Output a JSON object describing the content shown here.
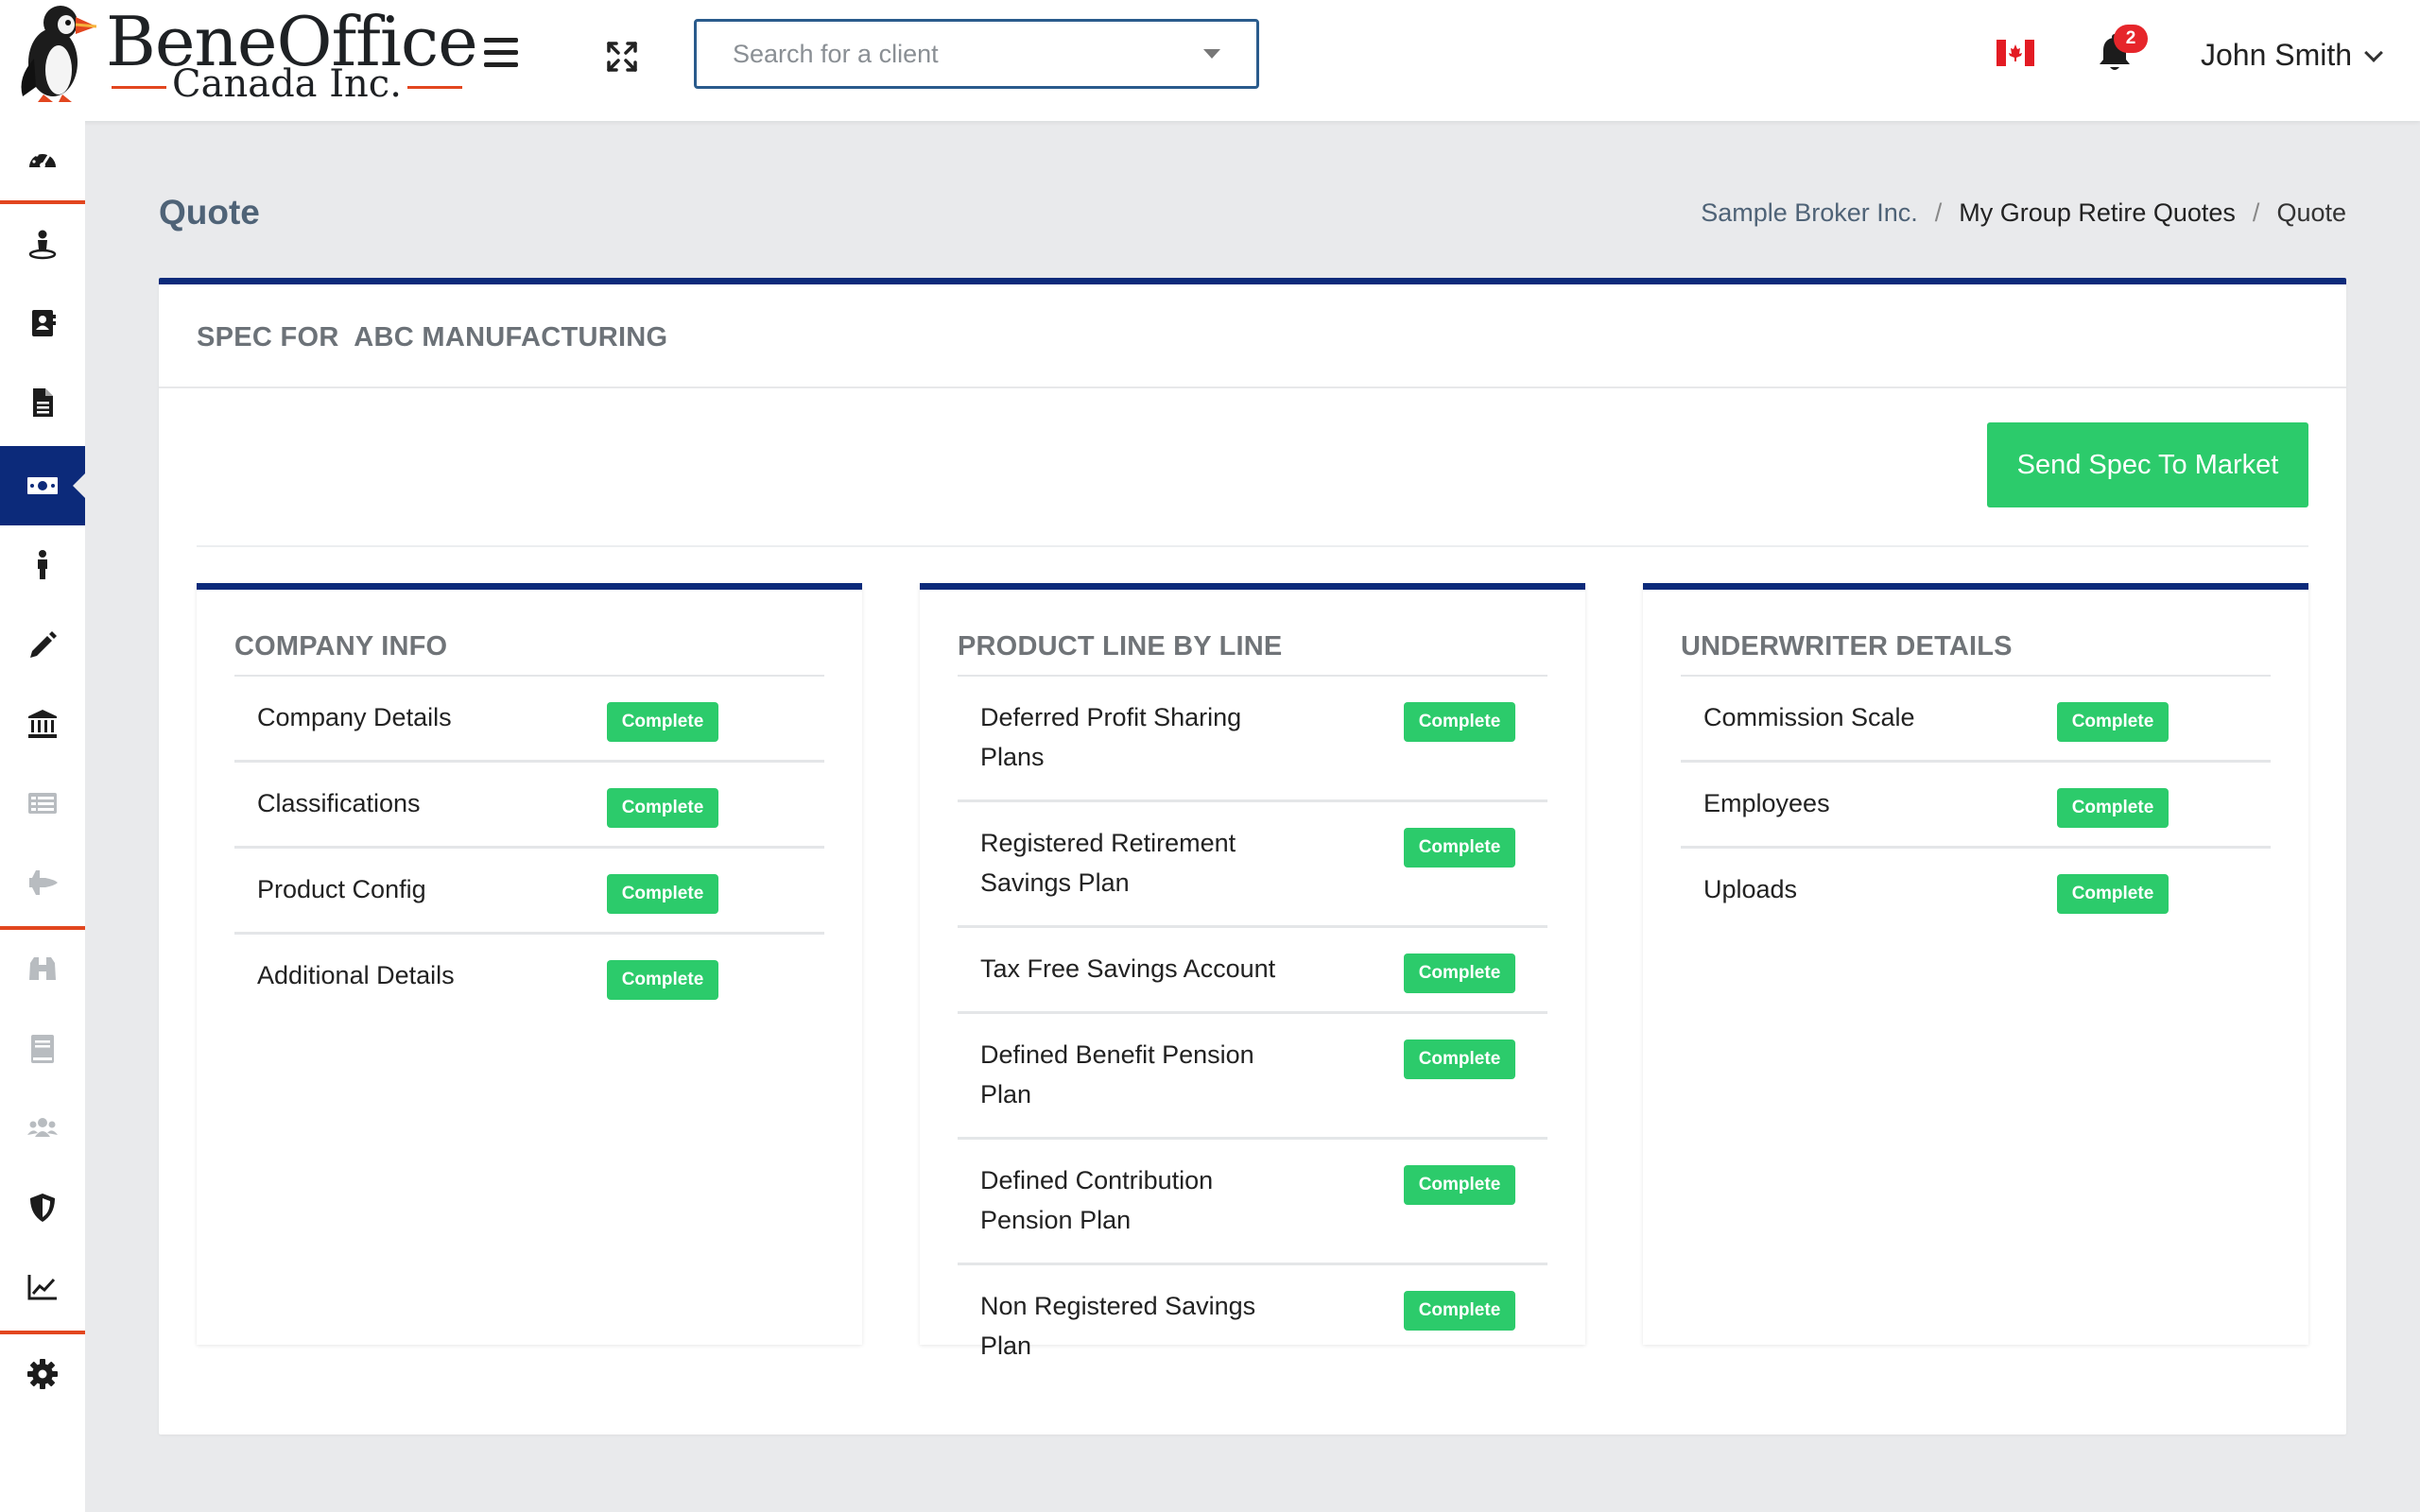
{
  "header": {
    "logo_title": "BeneOffice",
    "logo_subtitle": "Canada Inc.",
    "search_placeholder": "Search for a client",
    "notification_count": "2",
    "user_name": "John Smith",
    "flag": "canada-flag-icon"
  },
  "sidebar": {
    "items": [
      {
        "icon": "dashboard-icon"
      },
      {
        "icon": "user-location-icon"
      },
      {
        "icon": "address-book-icon"
      },
      {
        "icon": "document-icon"
      },
      {
        "icon": "money-bill-icon",
        "active": true
      },
      {
        "icon": "person-icon"
      },
      {
        "icon": "pencil-icon"
      },
      {
        "icon": "bank-icon"
      },
      {
        "icon": "list-icon"
      },
      {
        "icon": "shuttle-icon"
      },
      {
        "icon": "binoculars-icon"
      },
      {
        "icon": "book-icon"
      },
      {
        "icon": "users-icon"
      },
      {
        "icon": "shield-icon"
      },
      {
        "icon": "chart-line-icon"
      },
      {
        "icon": "cog-icon"
      }
    ]
  },
  "page": {
    "title": "Quote",
    "breadcrumb": [
      "Sample Broker Inc.",
      "My Group Retire Quotes",
      "Quote"
    ]
  },
  "card": {
    "title": "SPEC FOR  ABC MANUFACTURING",
    "send_button": "Send Spec To Market"
  },
  "panels": {
    "company": {
      "title": "COMPANY INFO",
      "rows": [
        {
          "label": "Company Details",
          "status": "Complete"
        },
        {
          "label": "Classifications",
          "status": "Complete"
        },
        {
          "label": "Product Config",
          "status": "Complete"
        },
        {
          "label": "Additional Details",
          "status": "Complete"
        }
      ]
    },
    "product": {
      "title": "PRODUCT LINE BY LINE",
      "rows": [
        {
          "label": "Deferred Profit Sharing Plans",
          "status": "Complete"
        },
        {
          "label": "Registered Retirement Savings Plan",
          "status": "Complete"
        },
        {
          "label": "Tax Free Savings Account",
          "status": "Complete"
        },
        {
          "label": "Defined Benefit Pension Plan",
          "status": "Complete"
        },
        {
          "label": "Defined Contribution Pension Plan",
          "status": "Complete"
        },
        {
          "label": "Non Registered Savings Plan",
          "status": "Complete"
        }
      ]
    },
    "underwriter": {
      "title": "UNDERWRITER DETAILS",
      "rows": [
        {
          "label": "Commission Scale",
          "status": "Complete"
        },
        {
          "label": "Employees",
          "status": "Complete"
        },
        {
          "label": "Uploads",
          "status": "Complete"
        }
      ]
    }
  },
  "colors": {
    "accent_navy": "#0c2a7a",
    "status_green": "#2ccb6b",
    "divider_orange": "#e2461f",
    "badge_red": "#e6262b"
  }
}
